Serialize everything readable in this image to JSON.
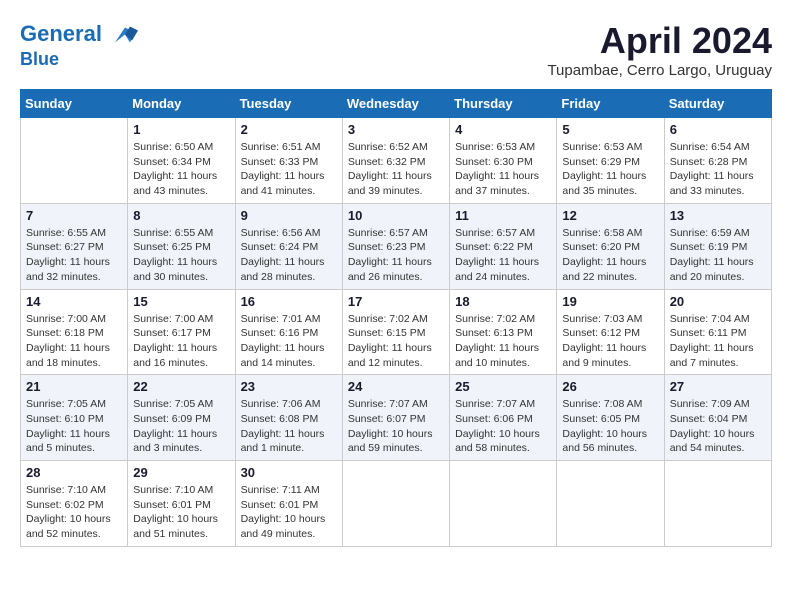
{
  "header": {
    "logo_line1": "General",
    "logo_line2": "Blue",
    "month": "April 2024",
    "location": "Tupambae, Cerro Largo, Uruguay"
  },
  "weekdays": [
    "Sunday",
    "Monday",
    "Tuesday",
    "Wednesday",
    "Thursday",
    "Friday",
    "Saturday"
  ],
  "weeks": [
    [
      {
        "day": "",
        "info": ""
      },
      {
        "day": "1",
        "info": "Sunrise: 6:50 AM\nSunset: 6:34 PM\nDaylight: 11 hours\nand 43 minutes."
      },
      {
        "day": "2",
        "info": "Sunrise: 6:51 AM\nSunset: 6:33 PM\nDaylight: 11 hours\nand 41 minutes."
      },
      {
        "day": "3",
        "info": "Sunrise: 6:52 AM\nSunset: 6:32 PM\nDaylight: 11 hours\nand 39 minutes."
      },
      {
        "day": "4",
        "info": "Sunrise: 6:53 AM\nSunset: 6:30 PM\nDaylight: 11 hours\nand 37 minutes."
      },
      {
        "day": "5",
        "info": "Sunrise: 6:53 AM\nSunset: 6:29 PM\nDaylight: 11 hours\nand 35 minutes."
      },
      {
        "day": "6",
        "info": "Sunrise: 6:54 AM\nSunset: 6:28 PM\nDaylight: 11 hours\nand 33 minutes."
      }
    ],
    [
      {
        "day": "7",
        "info": "Sunrise: 6:55 AM\nSunset: 6:27 PM\nDaylight: 11 hours\nand 32 minutes."
      },
      {
        "day": "8",
        "info": "Sunrise: 6:55 AM\nSunset: 6:25 PM\nDaylight: 11 hours\nand 30 minutes."
      },
      {
        "day": "9",
        "info": "Sunrise: 6:56 AM\nSunset: 6:24 PM\nDaylight: 11 hours\nand 28 minutes."
      },
      {
        "day": "10",
        "info": "Sunrise: 6:57 AM\nSunset: 6:23 PM\nDaylight: 11 hours\nand 26 minutes."
      },
      {
        "day": "11",
        "info": "Sunrise: 6:57 AM\nSunset: 6:22 PM\nDaylight: 11 hours\nand 24 minutes."
      },
      {
        "day": "12",
        "info": "Sunrise: 6:58 AM\nSunset: 6:20 PM\nDaylight: 11 hours\nand 22 minutes."
      },
      {
        "day": "13",
        "info": "Sunrise: 6:59 AM\nSunset: 6:19 PM\nDaylight: 11 hours\nand 20 minutes."
      }
    ],
    [
      {
        "day": "14",
        "info": "Sunrise: 7:00 AM\nSunset: 6:18 PM\nDaylight: 11 hours\nand 18 minutes."
      },
      {
        "day": "15",
        "info": "Sunrise: 7:00 AM\nSunset: 6:17 PM\nDaylight: 11 hours\nand 16 minutes."
      },
      {
        "day": "16",
        "info": "Sunrise: 7:01 AM\nSunset: 6:16 PM\nDaylight: 11 hours\nand 14 minutes."
      },
      {
        "day": "17",
        "info": "Sunrise: 7:02 AM\nSunset: 6:15 PM\nDaylight: 11 hours\nand 12 minutes."
      },
      {
        "day": "18",
        "info": "Sunrise: 7:02 AM\nSunset: 6:13 PM\nDaylight: 11 hours\nand 10 minutes."
      },
      {
        "day": "19",
        "info": "Sunrise: 7:03 AM\nSunset: 6:12 PM\nDaylight: 11 hours\nand 9 minutes."
      },
      {
        "day": "20",
        "info": "Sunrise: 7:04 AM\nSunset: 6:11 PM\nDaylight: 11 hours\nand 7 minutes."
      }
    ],
    [
      {
        "day": "21",
        "info": "Sunrise: 7:05 AM\nSunset: 6:10 PM\nDaylight: 11 hours\nand 5 minutes."
      },
      {
        "day": "22",
        "info": "Sunrise: 7:05 AM\nSunset: 6:09 PM\nDaylight: 11 hours\nand 3 minutes."
      },
      {
        "day": "23",
        "info": "Sunrise: 7:06 AM\nSunset: 6:08 PM\nDaylight: 11 hours\nand 1 minute."
      },
      {
        "day": "24",
        "info": "Sunrise: 7:07 AM\nSunset: 6:07 PM\nDaylight: 10 hours\nand 59 minutes."
      },
      {
        "day": "25",
        "info": "Sunrise: 7:07 AM\nSunset: 6:06 PM\nDaylight: 10 hours\nand 58 minutes."
      },
      {
        "day": "26",
        "info": "Sunrise: 7:08 AM\nSunset: 6:05 PM\nDaylight: 10 hours\nand 56 minutes."
      },
      {
        "day": "27",
        "info": "Sunrise: 7:09 AM\nSunset: 6:04 PM\nDaylight: 10 hours\nand 54 minutes."
      }
    ],
    [
      {
        "day": "28",
        "info": "Sunrise: 7:10 AM\nSunset: 6:02 PM\nDaylight: 10 hours\nand 52 minutes."
      },
      {
        "day": "29",
        "info": "Sunrise: 7:10 AM\nSunset: 6:01 PM\nDaylight: 10 hours\nand 51 minutes."
      },
      {
        "day": "30",
        "info": "Sunrise: 7:11 AM\nSunset: 6:01 PM\nDaylight: 10 hours\nand 49 minutes."
      },
      {
        "day": "",
        "info": ""
      },
      {
        "day": "",
        "info": ""
      },
      {
        "day": "",
        "info": ""
      },
      {
        "day": "",
        "info": ""
      }
    ]
  ]
}
